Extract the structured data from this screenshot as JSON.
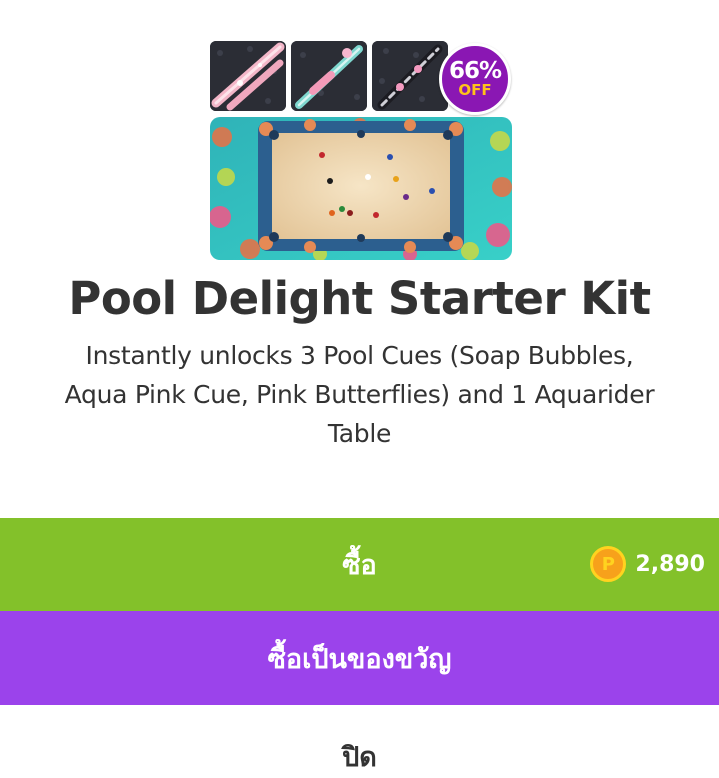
{
  "product": {
    "title": "Pool Delight Starter Kit",
    "description": "Instantly unlocks 3 Pool Cues (Soap Bubbles, Aqua Pink Cue, Pink Butterflies) and 1 Aquarider Table",
    "badge": {
      "percent": "66%",
      "label": "OFF"
    },
    "image_icons": [
      "soap-bubbles-cue",
      "aqua-pink-cue",
      "pink-butterflies-cue",
      "aquarider-table"
    ]
  },
  "actions": {
    "buy_label": "ซื้อ",
    "price": "2,890",
    "currency_icon": "coin-p-icon",
    "currency_symbol": "P",
    "gift_label": "ซื้อเป็นของขวัญ",
    "close_label": "ปิด"
  },
  "colors": {
    "buy": "#83c12a",
    "gift": "#9b43eb",
    "badge": "#8a17b3",
    "coin": "#f7a11b",
    "text": "#333333"
  }
}
